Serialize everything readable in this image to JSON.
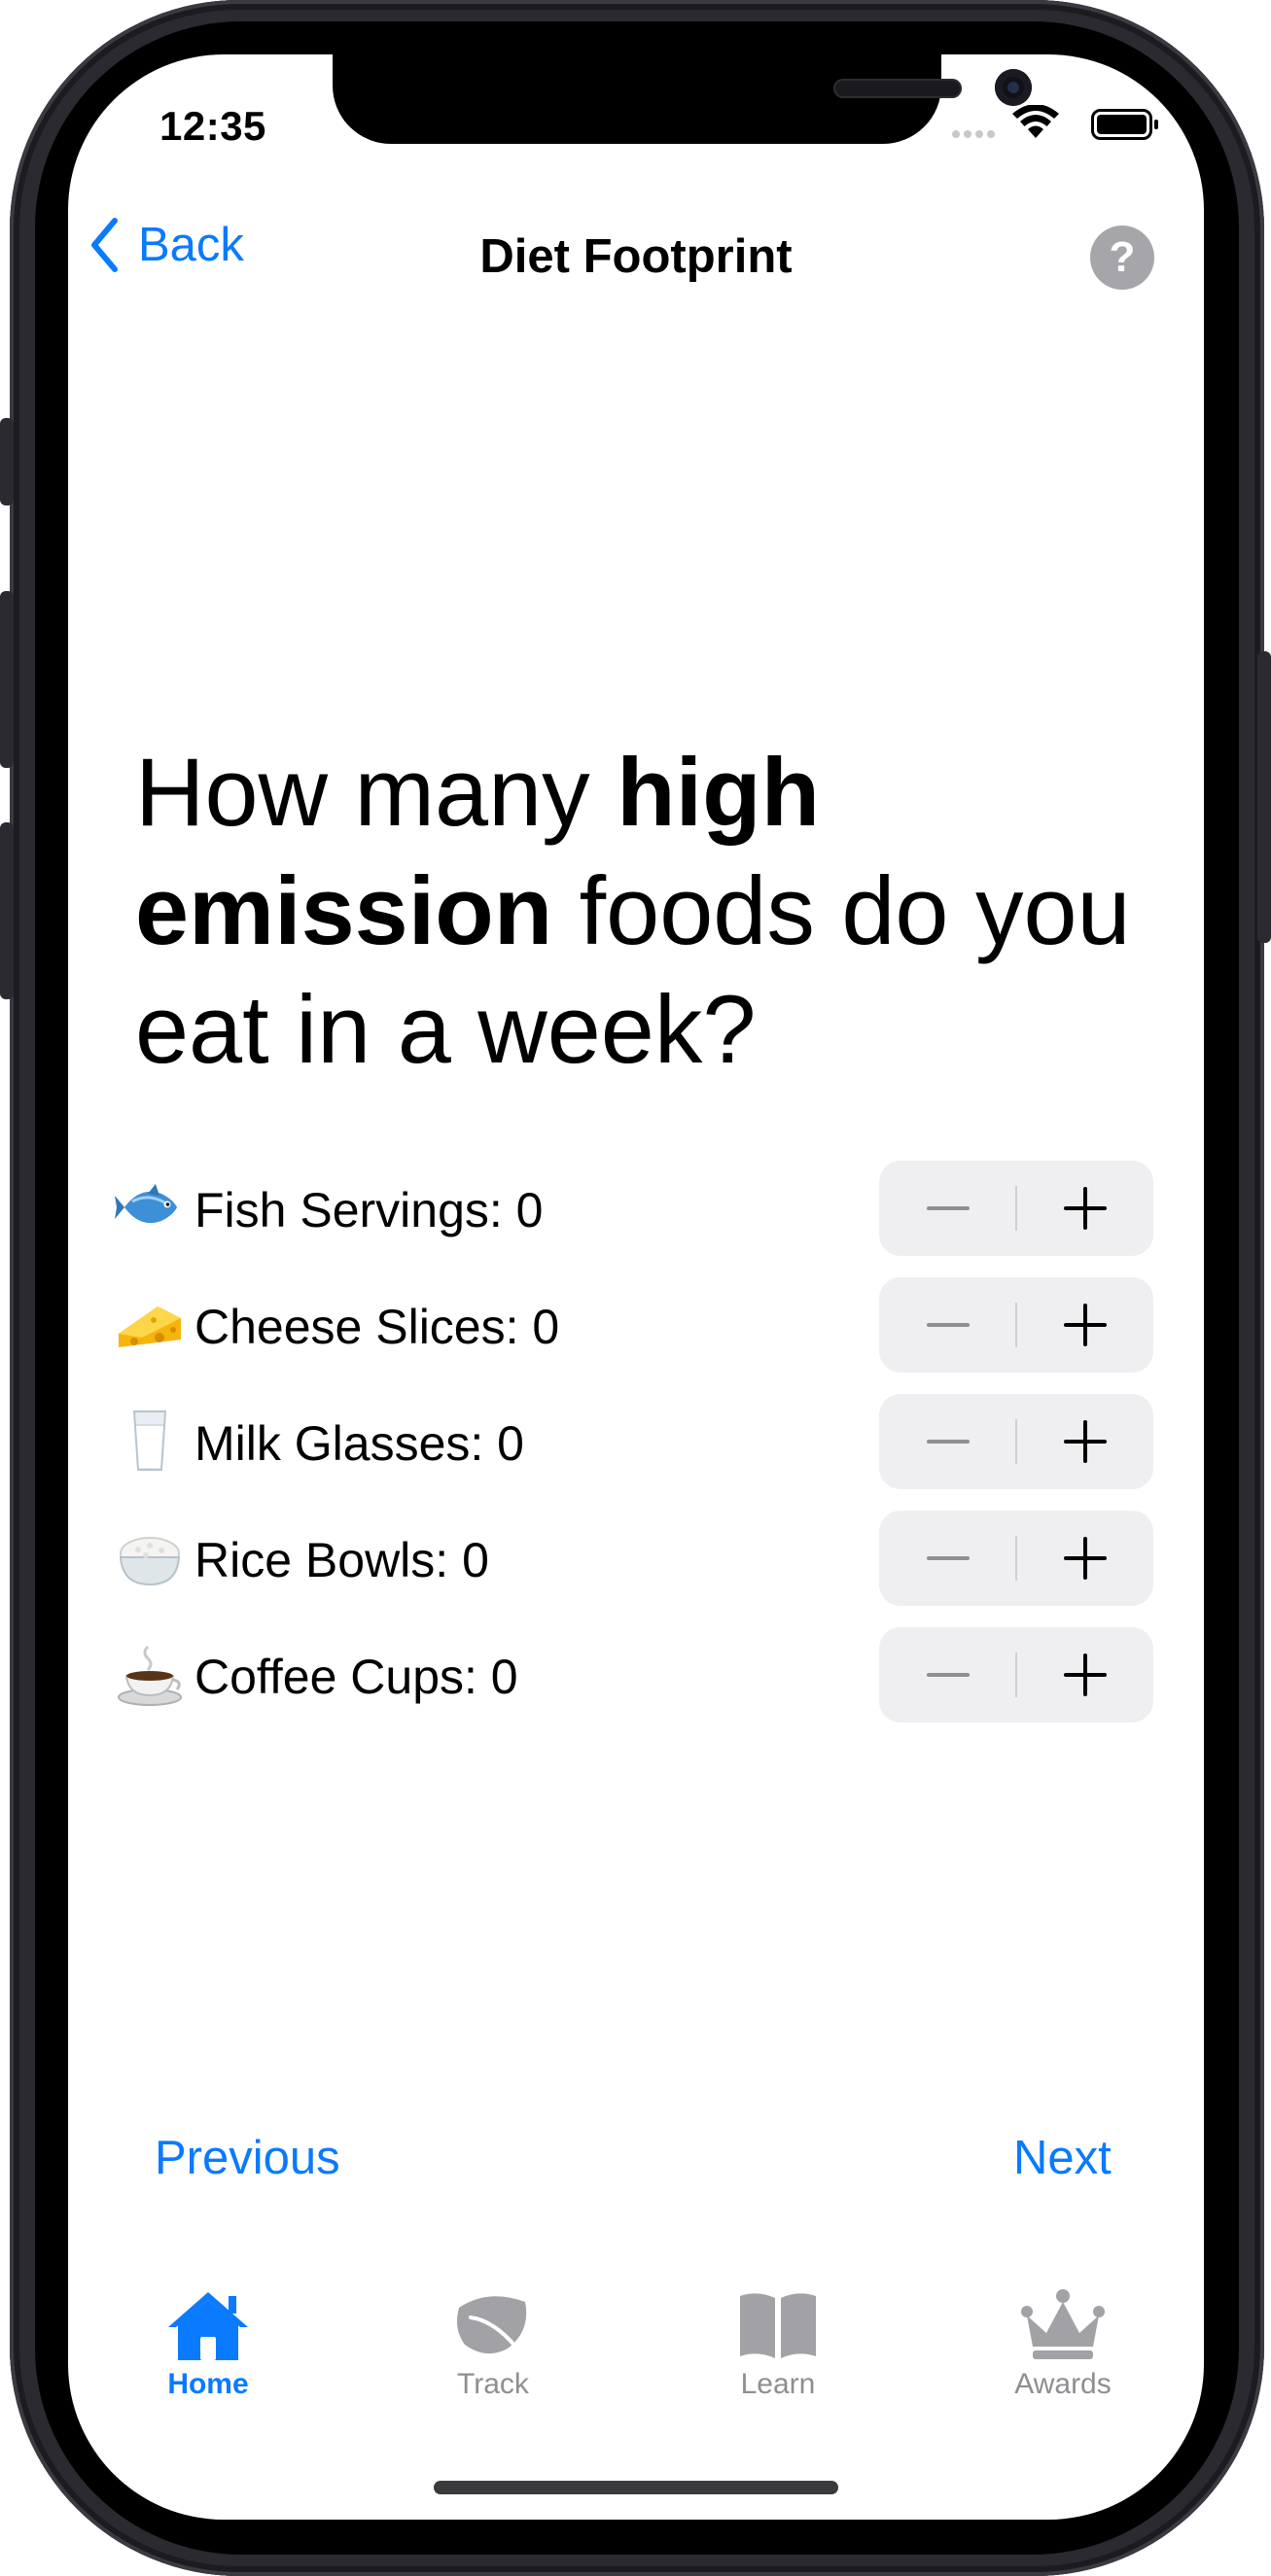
{
  "status_bar": {
    "time": "12:35"
  },
  "nav": {
    "back_label": "Back",
    "title": "Diet Footprint",
    "help_symbol": "?"
  },
  "question": {
    "part1": "How many ",
    "bold": "high emission",
    "part2": " foods do you eat in a week?"
  },
  "foods": [
    {
      "icon": "fish-icon",
      "label": "Fish Servings: 0"
    },
    {
      "icon": "cheese-icon",
      "label": "Cheese Slices: 0"
    },
    {
      "icon": "milk-icon",
      "label": "Milk Glasses: 0"
    },
    {
      "icon": "rice-icon",
      "label": "Rice Bowls: 0"
    },
    {
      "icon": "coffee-icon",
      "label": "Coffee Cups: 0"
    }
  ],
  "footer_nav": {
    "previous_label": "Previous",
    "next_label": "Next"
  },
  "tabs": [
    {
      "label": "Home",
      "icon": "house-icon",
      "active": true
    },
    {
      "label": "Track",
      "icon": "leaf-icon",
      "active": false
    },
    {
      "label": "Learn",
      "icon": "book-icon",
      "active": false
    },
    {
      "label": "Awards",
      "icon": "crown-icon",
      "active": false
    }
  ],
  "colors": {
    "accent": "#0a7aff",
    "inactive_tab": "#8e8e93",
    "stepper_bg": "#efeff1",
    "help_bg": "#a6a6aa"
  }
}
